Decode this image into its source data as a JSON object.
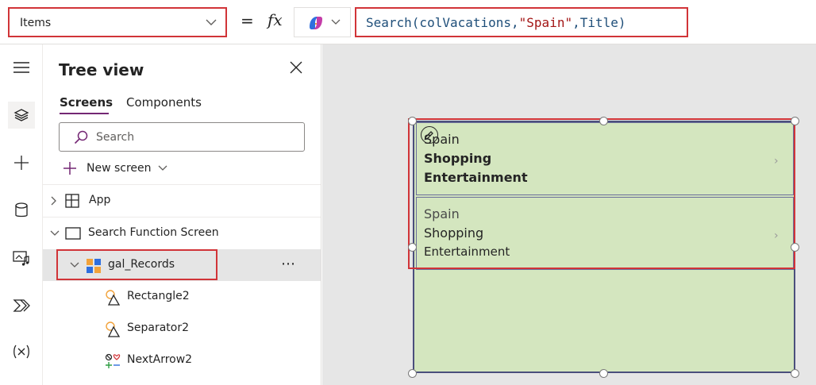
{
  "formula_bar": {
    "property": "Items",
    "equals": "=",
    "fx": "fx",
    "formula_prefix": "Search(colVacations,",
    "formula_string": "\"Spain\"",
    "formula_suffix": ",Title)"
  },
  "tree_view": {
    "title": "Tree view",
    "tabs": [
      "Screens",
      "Components"
    ],
    "search_placeholder": "Search",
    "new_screen": "New screen",
    "items": {
      "app": "App",
      "screen": "Search Function Screen",
      "gallery": "gal_Records",
      "more": "⋯",
      "rect": "Rectangle2",
      "separator": "Separator2",
      "arrow": "NextArrow2"
    }
  },
  "gallery": {
    "items": [
      {
        "title": "Spain",
        "line2": "Shopping",
        "line3": "Entertainment"
      },
      {
        "title": "Spain",
        "line2": "Shopping",
        "line3": "Entertainment"
      }
    ],
    "arrow": "›"
  },
  "colors": {
    "accent": "#742774",
    "highlight": "#d13438",
    "gallery_fill": "#d4e6bf"
  }
}
